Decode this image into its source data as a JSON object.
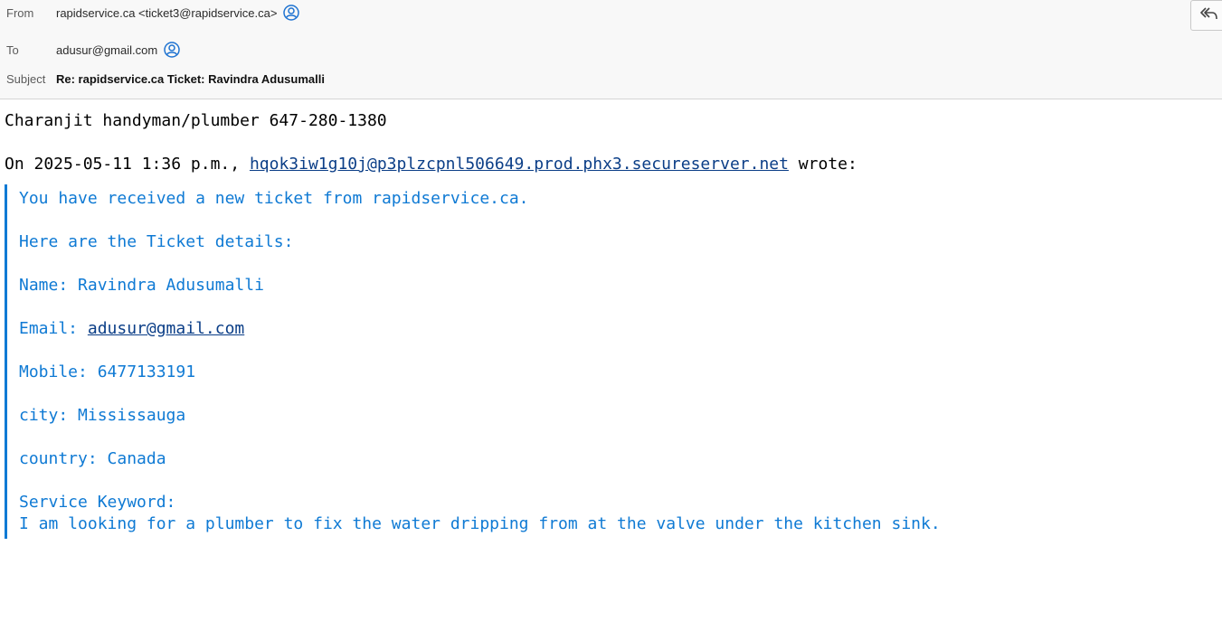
{
  "header": {
    "from_label": "From",
    "from_value": "rapidservice.ca <ticket3@rapidservice.ca>",
    "to_label": "To",
    "to_value": "adusur@gmail.com",
    "subject_label": "Subject",
    "subject_value": "Re: rapidservice.ca Ticket: Ravindra Adusumalli",
    "reply_icon": "reply-all-icon",
    "contact_icon": "contact-icon"
  },
  "message": {
    "reply_text": "Charanjit handyman/plumber 647-280-1380",
    "attribution_prefix": "On 2025-05-11 1:36 p.m., ",
    "attribution_link": "hqok3iw1g10j@p3plzcpnl506649.prod.phx3.secureserver.net",
    "attribution_suffix": " wrote:",
    "quote": {
      "intro": "You have received a new ticket from rapidservice.ca.",
      "details_heading": "Here are the Ticket details:",
      "name": "Name: Ravindra Adusumalli",
      "email_label": "Email: ",
      "email_link": "adusur@gmail.com",
      "mobile": "Mobile: 6477133191",
      "city": "city: Mississauga",
      "country": "country: Canada",
      "service_keyword_label": "Service Keyword:",
      "service_keyword_text": "I am looking for a plumber to fix the water dripping from at the valve under the kitchen sink."
    }
  },
  "colors": {
    "quote_text": "#0f7ad4",
    "quote_bar": "#0f7ad4",
    "link": "#0b3e87",
    "header_bg": "#f8f8f8"
  }
}
